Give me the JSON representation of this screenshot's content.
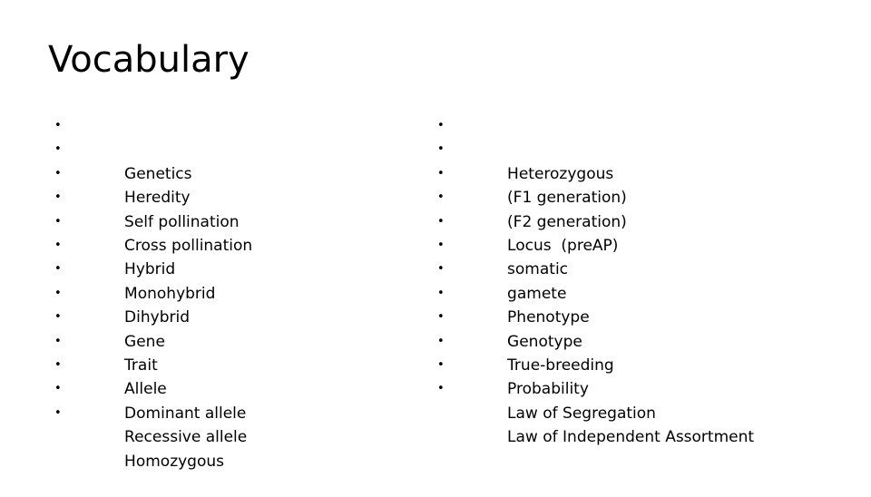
{
  "slide": {
    "title": "Vocabulary",
    "bullet_glyph": "•",
    "text_color": "#000000",
    "background_color": "#FFFFFF",
    "columns": [
      {
        "name": "left-column",
        "items": [
          "Genetics",
          "Heredity",
          "Self pollination",
          "Cross pollination",
          "Hybrid",
          "Monohybrid",
          "Dihybrid",
          "Gene",
          "Trait",
          "Allele",
          "Dominant allele",
          "Recessive allele",
          "Homozygous"
        ]
      },
      {
        "name": "right-column",
        "items": [
          "Heterozygous",
          "(F1 generation)",
          "(F2 generation)",
          "Locus  (preAP)",
          "somatic",
          "gamete",
          "Phenotype",
          "Genotype",
          "True-breeding",
          "Probability",
          "Law of Segregation",
          "Law of Independent Assortment"
        ]
      }
    ]
  }
}
